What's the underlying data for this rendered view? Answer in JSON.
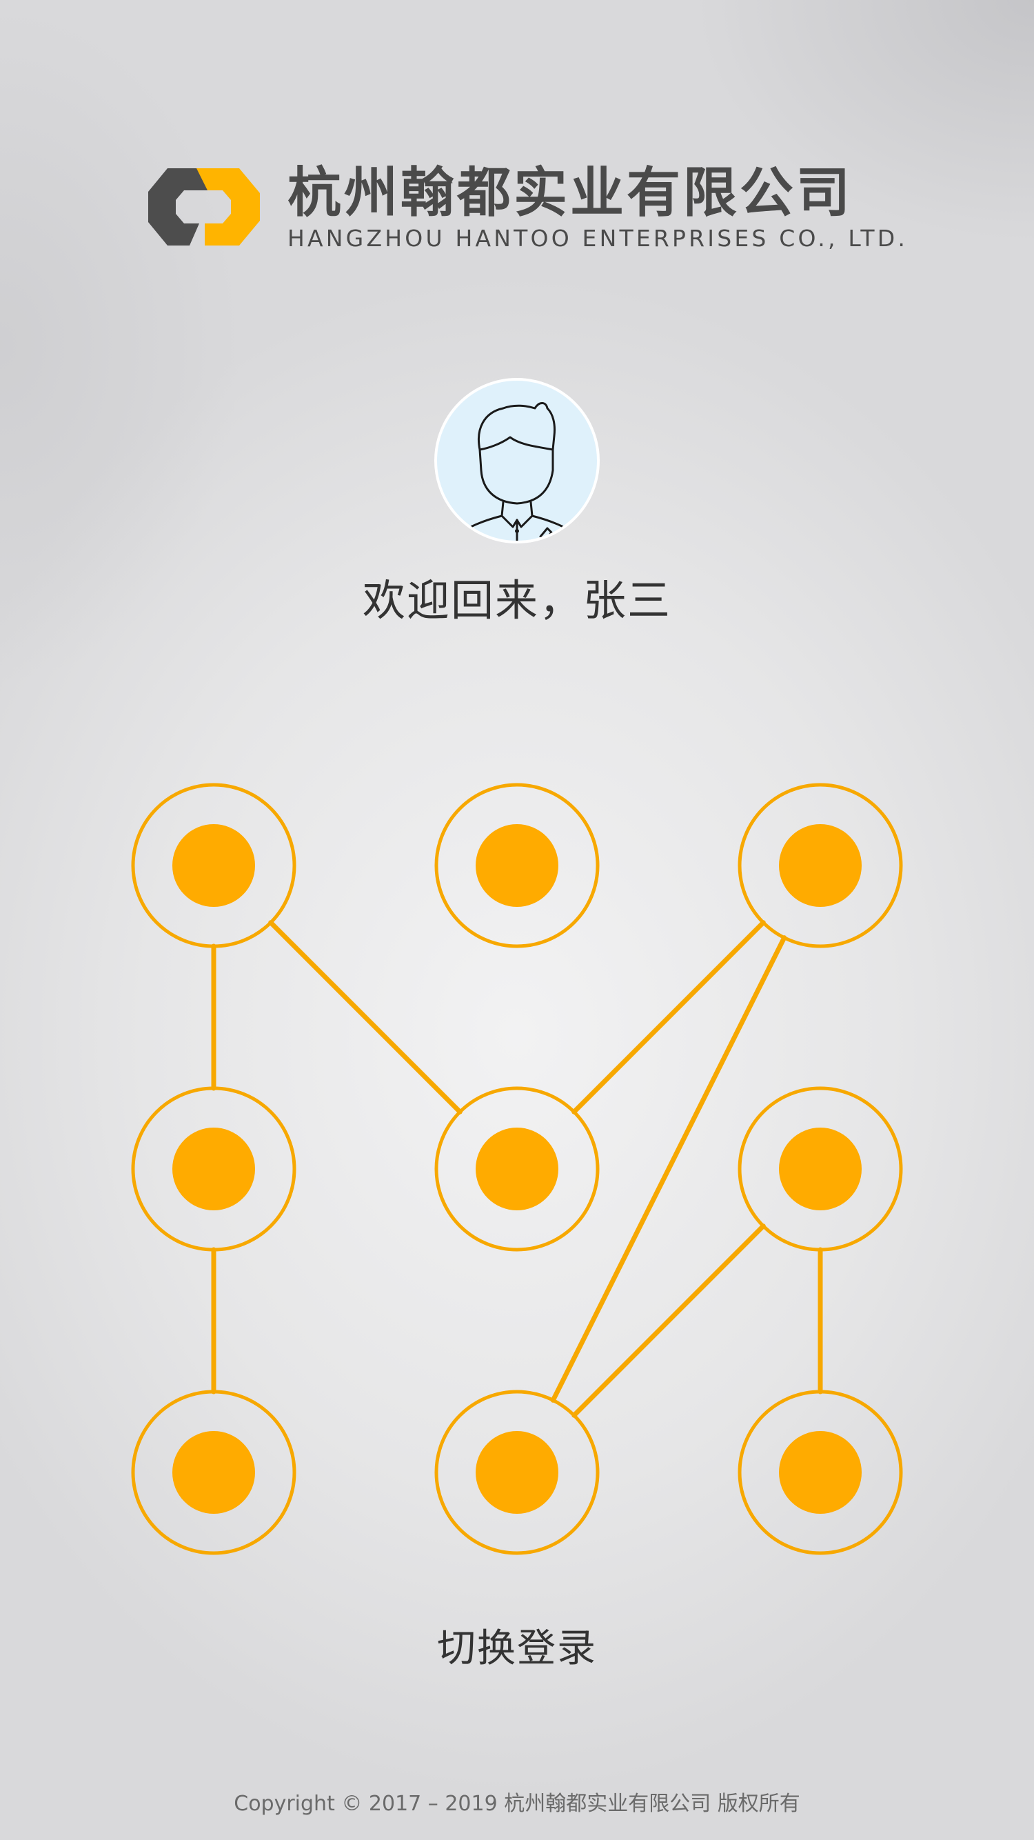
{
  "logo": {
    "company_cn": "杭州翰都实业有限公司",
    "company_en": "HANGZHOU HANTOO ENTERPRISES CO., LTD."
  },
  "user": {
    "welcome": "欢迎回来，张三"
  },
  "pattern": {
    "accent_color": "#f7a800",
    "dot_fill": "#ffab00",
    "nodes_count": 9,
    "path_sequence": [
      7,
      4,
      1,
      5,
      3,
      8,
      6,
      9
    ]
  },
  "actions": {
    "switch_login": "切换登录"
  },
  "footer": {
    "copyright": "Copyright © 2017 – 2019 杭州翰都实业有限公司 版权所有"
  }
}
